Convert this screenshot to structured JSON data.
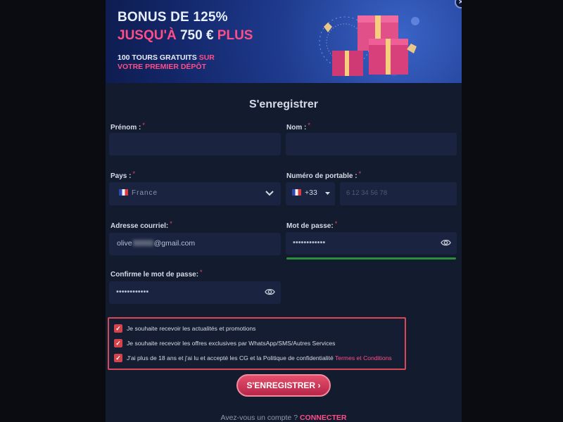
{
  "banner": {
    "line1": "BONUS DE 125%",
    "line2_prefix": "JUSQU'À ",
    "line2_amount": "750 €",
    "line2_suffix": " PLUS",
    "line3_part1": "100 TOURS GRATUITS ",
    "line3_part2": "SUR",
    "line4": "VOTRE PREMIER DÉPÔT",
    "close_icon": "×"
  },
  "form": {
    "title": "S'enregistrer",
    "required_mark": "*",
    "firstname_label": "Prénom :",
    "lastname_label": "Nom :",
    "country_label": "Pays :",
    "country_value": "France",
    "phone_label": "Numéro de portable :",
    "phone_code": "+33",
    "phone_placeholder": "6 12 34 56 78",
    "email_label": "Adresse courriel:",
    "email_value_start": "olive",
    "email_value_end": "@gmail.com",
    "password_label": "Mot de passe:",
    "password_value": "••••••••••••",
    "confirm_label": "Confirme le mot de passe:",
    "confirm_value": "••••••••••••",
    "password_strength": 1.0
  },
  "consents": [
    {
      "text": "Je souhaite recevoir les actualités et promotions",
      "link": ""
    },
    {
      "text": "Je souhaite recevoir les offres exclusives par WhatsApp/SMS/Autres Services",
      "link": ""
    },
    {
      "text": "J'ai plus de 18 ans et j'ai lu et accepté les CG et la Politique de confidentialité ",
      "link": "Termes et Conditions"
    }
  ],
  "submit_label": "S'ENREGISTRER",
  "footer": {
    "text": "Avez-vous un compte ?",
    "link": "CONNECTER"
  },
  "colors": {
    "accent": "#ff4e86",
    "modal_bg": "#131b2f",
    "field_bg": "#1a2440",
    "checkbox": "#d6424c",
    "strength": "#2c8f3a"
  }
}
